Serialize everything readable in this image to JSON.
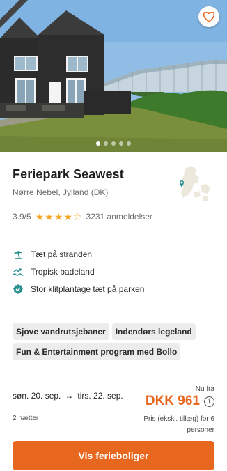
{
  "hero": {
    "photo_alt": "",
    "carousel_total": 5,
    "carousel_active": 1
  },
  "property": {
    "name": "Feriepark Seawest",
    "location": "Nørre Nebel, Jylland (DK)",
    "rating": "3.9/5",
    "stars_filled": 4,
    "stars_total": 5,
    "reviews": "3231 anmeldelser"
  },
  "features": [
    {
      "icon": "beach-umbrella-icon",
      "label": "Tæt på stranden"
    },
    {
      "icon": "swimming-icon",
      "label": "Tropisk badeland"
    },
    {
      "icon": "check-badge-icon",
      "label": "Stor klitplantage tæt på parken"
    }
  ],
  "tags": [
    "Sjove vandrutsjebaner",
    "Indendørs legeland",
    "Fun & Entertainment program med Bollo"
  ],
  "booking": {
    "date_from": "søn. 20. sep.",
    "arrow": "→",
    "date_to": "tirs. 22. sep.",
    "nights": "2 nætter",
    "from_label": "Nu fra",
    "price": "DKK 961",
    "info_glyph": "i",
    "price_note": "Pris (ekskl. tillæg) for 6 personer"
  },
  "cta": {
    "label": "Vis ferieboliger"
  },
  "colors": {
    "accent": "#e8671f",
    "teal": "#2a8f8f",
    "star": "#f5a623"
  }
}
